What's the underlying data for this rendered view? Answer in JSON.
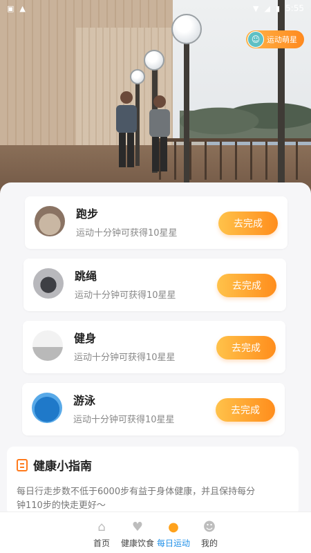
{
  "status_bar": {
    "time": "5:55"
  },
  "badge": {
    "label": "运动萌星"
  },
  "tasks": [
    {
      "title": "跑步",
      "desc": "运动十分钟可获得10星星",
      "action": "去完成"
    },
    {
      "title": "跳绳",
      "desc": "运动十分钟可获得10星星",
      "action": "去完成"
    },
    {
      "title": "健身",
      "desc": "运动十分钟可获得10星星",
      "action": "去完成"
    },
    {
      "title": "游泳",
      "desc": "运动十分钟可获得10星星",
      "action": "去完成"
    }
  ],
  "guide": {
    "title": "健康小指南",
    "body": "每日行走步数不低于6000步有益于身体健康，并且保持每分钟110步的快走更好～"
  },
  "tabbar": {
    "items": [
      {
        "label": "首页",
        "icon": "home-icon"
      },
      {
        "label": "健康饮食",
        "icon": "heart-plus-icon"
      },
      {
        "label": "每日运动",
        "icon": "basketball-icon"
      },
      {
        "label": "我的",
        "icon": "user-icon"
      }
    ],
    "active_index": 2
  },
  "colors": {
    "accent_orange": "#ff8d1c",
    "active_tab_blue": "#1e8fe8"
  }
}
